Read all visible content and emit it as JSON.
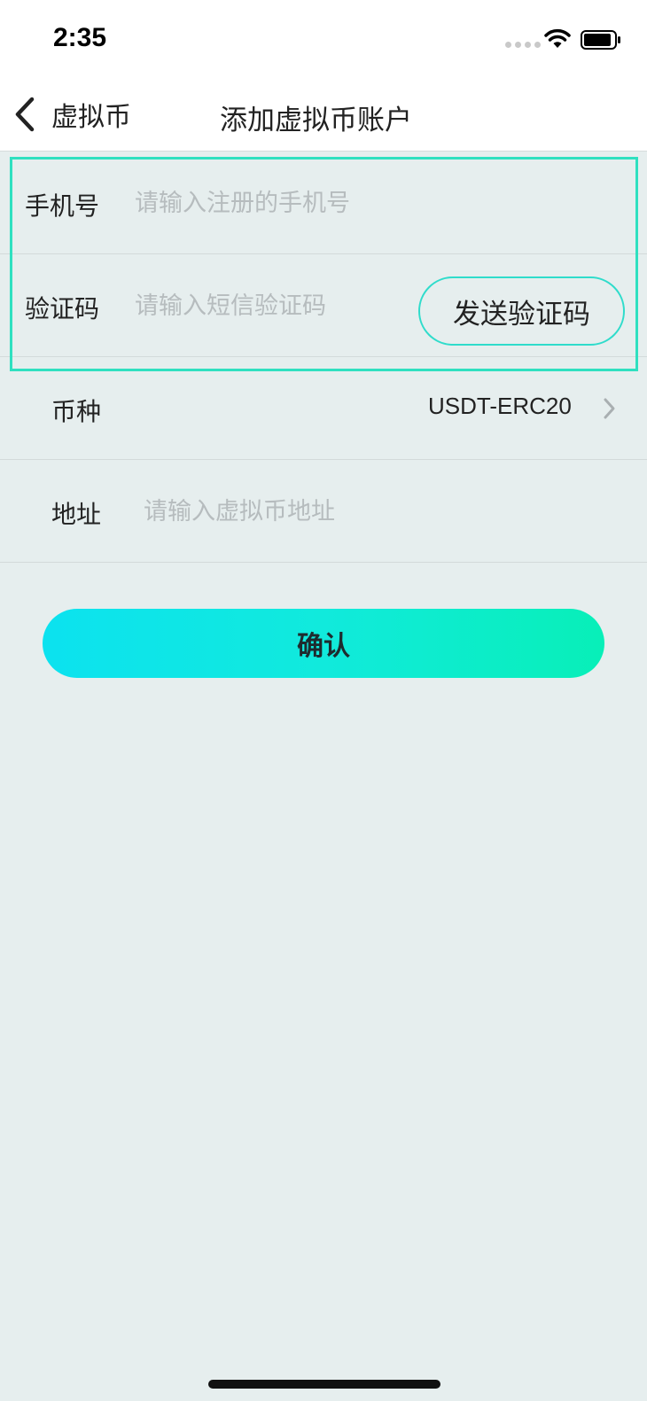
{
  "status_bar": {
    "time": "2:35"
  },
  "nav": {
    "back_label": "虚拟币",
    "title": "添加虚拟币账户"
  },
  "form": {
    "phone": {
      "label": "手机号",
      "placeholder": "请输入注册的手机号",
      "value": ""
    },
    "code": {
      "label": "验证码",
      "placeholder": "请输入短信验证码",
      "value": "",
      "send_button": "发送验证码"
    },
    "currency": {
      "label": "币种",
      "value": "USDT-ERC20"
    },
    "address": {
      "label": "地址",
      "placeholder": "请输入虚拟币地址",
      "value": ""
    }
  },
  "confirm_button": "确认",
  "colors": {
    "background": "#e6eeee",
    "accent": "#2fe0c0",
    "button_gradient_start": "#0ce2ef",
    "button_gradient_end": "#08efb8"
  },
  "icons": [
    "signal-dots-icon",
    "wifi-icon",
    "battery-icon",
    "back-chevron-icon",
    "chevron-right-icon"
  ]
}
